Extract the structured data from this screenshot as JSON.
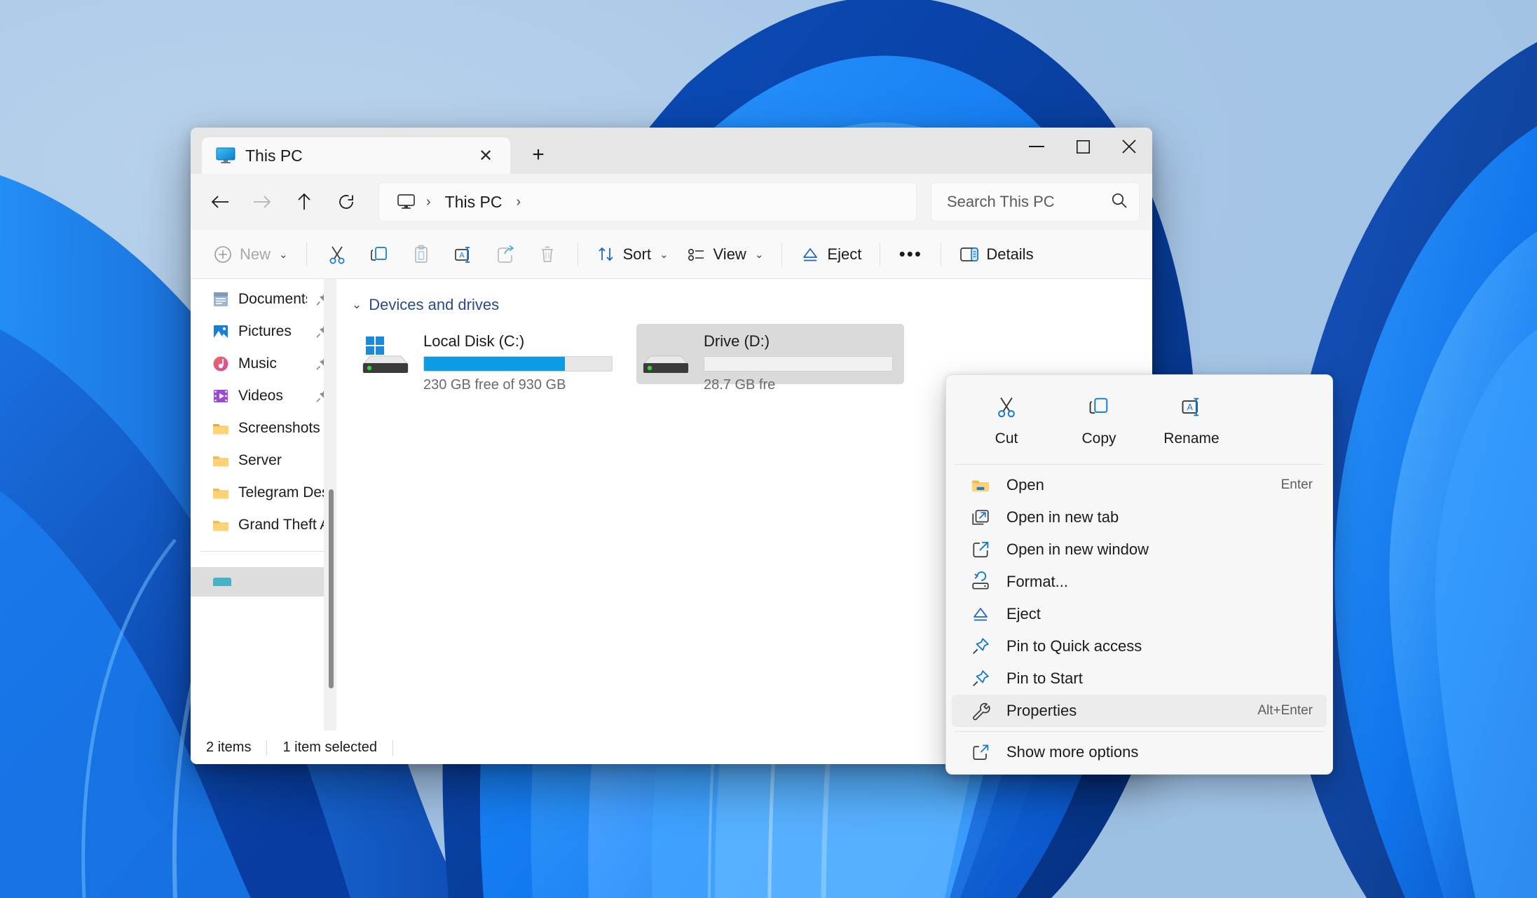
{
  "window": {
    "tab_title": "This PC",
    "tab_icon": "this-pc-monitor-icon",
    "close_tab_label": "✕",
    "new_tab_label": "+",
    "controls": {
      "minimize": "─",
      "maximize": "□",
      "close": "✕"
    }
  },
  "nav": {
    "back": "back-arrow-icon",
    "forward": "forward-arrow-icon",
    "up": "up-arrow-icon",
    "refresh": "refresh-icon",
    "breadcrumb": {
      "root_icon": "this-pc-monitor-icon",
      "sep": "›",
      "items": [
        "This PC"
      ]
    }
  },
  "search": {
    "placeholder": "Search This PC",
    "icon": "search-icon"
  },
  "toolbar": {
    "new_label": "New",
    "cut_label": "cut-icon",
    "copy_label": "copy-icon",
    "paste_label": "paste-icon",
    "rename_label": "rename-icon",
    "share_label": "share-icon",
    "delete_label": "delete-icon",
    "sort_label": "Sort",
    "view_label": "View",
    "eject_label": "Eject",
    "more_label": "•••",
    "details_label": "Details",
    "chevron": "⌄"
  },
  "sidebar": {
    "items": [
      {
        "label": "Documents",
        "icon": "documents-icon",
        "pinned": true
      },
      {
        "label": "Pictures",
        "icon": "pictures-icon",
        "pinned": true
      },
      {
        "label": "Music",
        "icon": "music-icon",
        "pinned": true
      },
      {
        "label": "Videos",
        "icon": "videos-icon",
        "pinned": true
      },
      {
        "label": "Screenshots",
        "icon": "folder-icon",
        "pinned": false
      },
      {
        "label": "Server",
        "icon": "folder-icon",
        "pinned": false
      },
      {
        "label": "Telegram Desktop",
        "icon": "folder-icon",
        "pinned": false
      },
      {
        "label": "Grand Theft Auto V",
        "icon": "folder-icon",
        "pinned": false
      }
    ]
  },
  "main": {
    "group_title": "Devices and drives",
    "group_chevron": "⌄",
    "drives": [
      {
        "name": "Local Disk (C:)",
        "capacity_text": "230 GB free of 930 GB",
        "used_percent": 75,
        "selected": false,
        "icon": "windows-drive-icon"
      },
      {
        "name": "Drive (D:)",
        "capacity_text": "28.7 GB fre",
        "used_percent": 0,
        "selected": true,
        "icon": "drive-icon"
      }
    ]
  },
  "status": {
    "items_count": "2 items",
    "selection": "1 item selected"
  },
  "context_menu": {
    "top_actions": [
      {
        "label": "Cut",
        "icon": "cut-icon"
      },
      {
        "label": "Copy",
        "icon": "copy-icon"
      },
      {
        "label": "Rename",
        "icon": "rename-icon"
      }
    ],
    "items": [
      {
        "label": "Open",
        "icon": "folder-open-icon",
        "accel": "Enter",
        "highlighted": false
      },
      {
        "label": "Open in new tab",
        "icon": "open-new-tab-icon",
        "accel": "",
        "highlighted": false
      },
      {
        "label": "Open in new window",
        "icon": "open-new-window-icon",
        "accel": "",
        "highlighted": false
      },
      {
        "label": "Format...",
        "icon": "format-disk-icon",
        "accel": "",
        "highlighted": false
      },
      {
        "label": "Eject",
        "icon": "eject-icon",
        "accel": "",
        "highlighted": false
      },
      {
        "label": "Pin to Quick access",
        "icon": "pin-icon",
        "accel": "",
        "highlighted": false
      },
      {
        "label": "Pin to Start",
        "icon": "pin-icon",
        "accel": "",
        "highlighted": false
      },
      {
        "label": "Properties",
        "icon": "wrench-icon",
        "accel": "Alt+Enter",
        "highlighted": true
      }
    ],
    "footer": {
      "label": "Show more options",
      "icon": "show-more-options-icon"
    }
  },
  "colors": {
    "accent_blue": "#0c9ce3",
    "icon_blue": "#0f6cbd",
    "desktop_blue": "#1b7ced",
    "wallpaper_sky": "#a9c9e8",
    "selection_gray": "#dadada",
    "menu_bg": "#f7f7f7"
  }
}
